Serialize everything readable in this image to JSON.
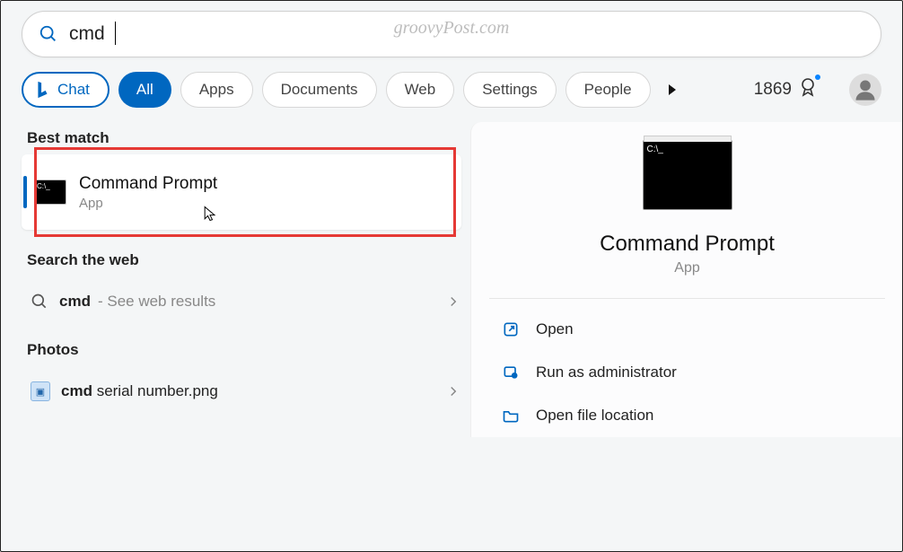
{
  "watermark": "groovyPost.com",
  "search": {
    "value": "cmd"
  },
  "tabs": {
    "chat": "Chat",
    "all": "All",
    "more": [
      "Apps",
      "Documents",
      "Web",
      "Settings",
      "People"
    ]
  },
  "rewards": {
    "points": "1869"
  },
  "left": {
    "best_match_heading": "Best match",
    "best_match": {
      "title": "Command Prompt",
      "subtitle": "App"
    },
    "search_web_heading": "Search the web",
    "web": {
      "query_bold": "cmd",
      "hint": "- See web results"
    },
    "photos_heading": "Photos",
    "photo": {
      "bold": "cmd",
      "rest": " serial number.png"
    }
  },
  "right": {
    "title": "Command Prompt",
    "subtitle": "App",
    "actions": {
      "open": "Open",
      "admin": "Run as administrator",
      "location": "Open file location"
    }
  }
}
